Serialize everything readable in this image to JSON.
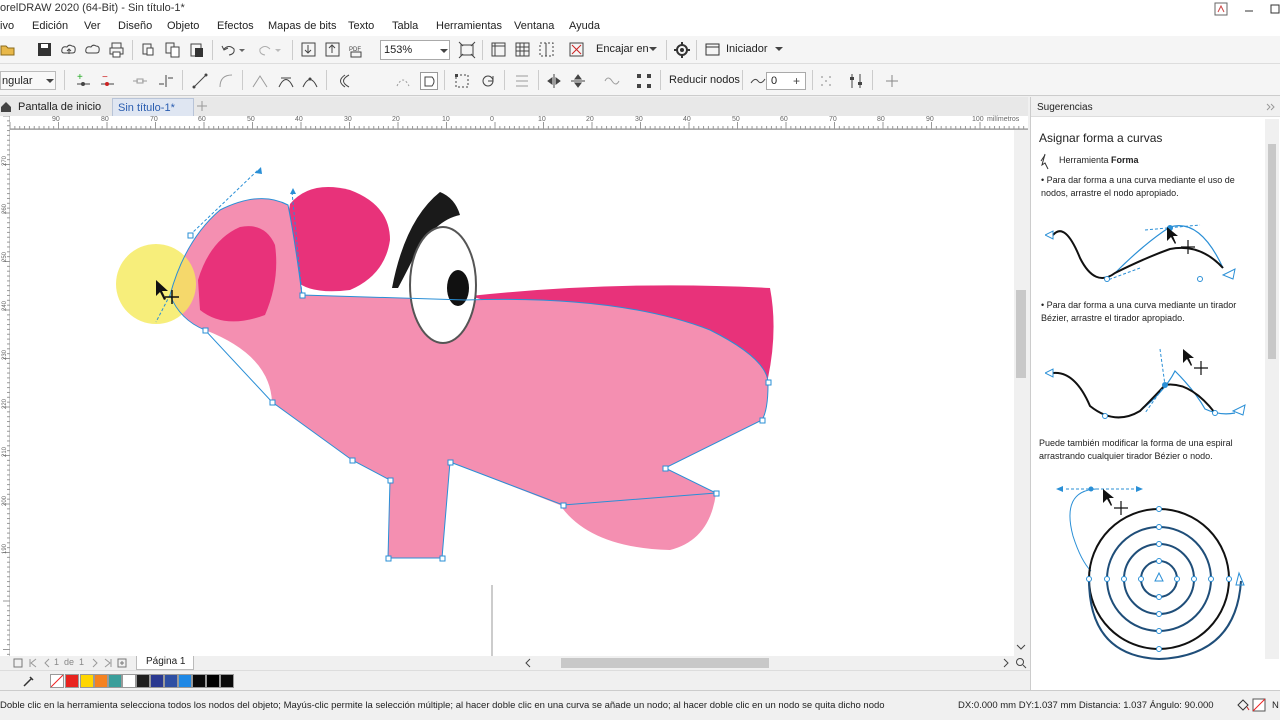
{
  "window": {
    "title": "orelDRAW 2020 (64-Bit) - Sin título-1*"
  },
  "menu": {
    "items": [
      "ivo",
      "Edición",
      "Ver",
      "Diseño",
      "Objeto",
      "Efectos",
      "Mapas de bits",
      "Texto",
      "Tabla",
      "Herramientas",
      "Ventana",
      "Ayuda"
    ]
  },
  "toolbar": {
    "zoom_value": "153%",
    "fit_label": "Encajar en",
    "launch_label": "Iniciador"
  },
  "property_bar": {
    "node_type": "ngular",
    "reduce_nodes_label": "Reducir nodos",
    "smoothing_value": "0"
  },
  "tabs": {
    "home": "Pantalla de inicio",
    "document": "Sin título-1*"
  },
  "ruler": {
    "h_ticks": [
      "90",
      "80",
      "70",
      "60",
      "50",
      "40",
      "30",
      "20",
      "10",
      "0",
      "10",
      "20",
      "30",
      "40",
      "50",
      "60",
      "70",
      "80",
      "90",
      "100"
    ],
    "unit": "milímetros",
    "v_ticks": [
      "270",
      "260",
      "250",
      "240",
      "230",
      "220",
      "210",
      "200",
      "190"
    ]
  },
  "page_nav": {
    "current": "1",
    "of_label": "de",
    "total": "1",
    "page_tab": "Página 1"
  },
  "palette": {
    "colors": [
      "#ffffff",
      "#e8231e",
      "#ffd600",
      "#f58220",
      "#3a9e9a",
      "#ffffff",
      "#1e1e1e",
      "#2a3990",
      "#2e4fa3",
      "#1e88e5",
      "#0a0a0a",
      "#000000"
    ]
  },
  "status": {
    "hint": "Doble clic en la herramienta selecciona todos los nodos del objeto; Mayús-clic permite la selección múltiple; al hacer doble clic en una curva se añade un nodo; al hacer doble clic en un nodo se quita dicho nodo",
    "coords": "DX:0.000 mm DY:1.037 mm Distancia: 1.037 Ángulo: 90.000",
    "trailing": "N"
  },
  "docker": {
    "header": "Sugerencias",
    "title": "Asignar forma a curvas",
    "tool_prefix": "Herramienta ",
    "tool_name": "Forma",
    "tip1": "• Para dar forma a una curva mediante el uso de nodos, arrastre el nodo apropiado.",
    "tip2": "• Para dar forma a una curva mediante un tirador Bézier, arrastre el tirador apropiado.",
    "tip3": "Puede también modificar la forma de una espiral arrastrando cualquier tirador Bézier o nodo."
  },
  "colors": {
    "shape_pink": "#f48fb1",
    "shape_magenta": "#e8327a",
    "node_blue": "#2a8fd6",
    "highlight_yellow": "#f5ea5a",
    "spiral_dark": "#1f4e79"
  }
}
